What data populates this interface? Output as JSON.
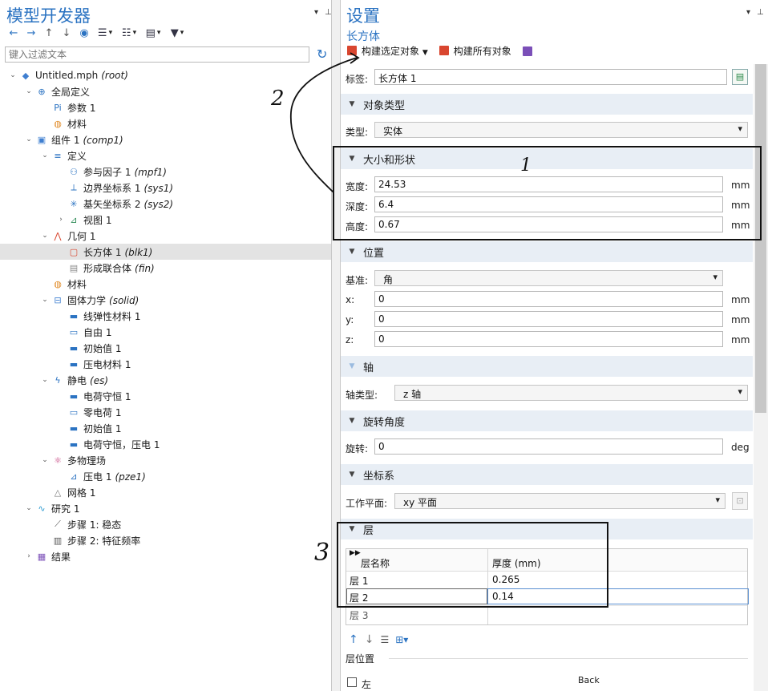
{
  "left_panel": {
    "title": "模型开发器",
    "toolbar": [
      "back-arrow-icon",
      "forward-arrow-icon",
      "up-arrow-icon",
      "down-arrow-icon",
      "eye-icon",
      "expand-icon",
      "collapse-icon",
      "list-icon",
      "pin-menu-icon"
    ],
    "filter_placeholder": "键入过滤文本",
    "tree": [
      {
        "indent": 0,
        "caret": "v",
        "icon": "file-root-icon",
        "label": "Untitled.mph",
        "tag": "(root)",
        "color": "#3f7fd0"
      },
      {
        "indent": 1,
        "caret": "v",
        "icon": "globe-icon",
        "label": "全局定义",
        "tag": "",
        "color": "#2b73c2"
      },
      {
        "indent": 2,
        "caret": "",
        "icon": "param-icon",
        "label": "参数 1",
        "tag": "",
        "color": "#2b73c2"
      },
      {
        "indent": 2,
        "caret": "",
        "icon": "material-icon",
        "label": "材料",
        "tag": "",
        "color": "#e08a25"
      },
      {
        "indent": 1,
        "caret": "v",
        "icon": "component-icon",
        "label": "组件 1",
        "tag": "(comp1)",
        "color": "#3f7fd0"
      },
      {
        "indent": 2,
        "caret": "v",
        "icon": "definitions-icon",
        "label": "定义",
        "tag": "",
        "color": "#2b73c2"
      },
      {
        "indent": 3,
        "caret": "",
        "icon": "participation-icon",
        "label": "参与因子 1",
        "tag": "(mpf1)",
        "color": "#2b73c2"
      },
      {
        "indent": 3,
        "caret": "",
        "icon": "boundary-system-icon",
        "label": "边界坐标系 1",
        "tag": "(sys1)",
        "color": "#2b73c2"
      },
      {
        "indent": 3,
        "caret": "",
        "icon": "base-vector-icon",
        "label": "基矢坐标系 2",
        "tag": "(sys2)",
        "color": "#2b73c2"
      },
      {
        "indent": 3,
        "caret": ">",
        "icon": "view-icon",
        "label": "视图 1",
        "tag": "",
        "color": "#2e8b57"
      },
      {
        "indent": 2,
        "caret": "v",
        "icon": "geometry-icon",
        "label": "几何 1",
        "tag": "",
        "color": "#d9462f"
      },
      {
        "indent": 3,
        "caret": "",
        "icon": "block-icon",
        "label": "长方体 1",
        "tag": "(blk1)",
        "color": "#d9462f",
        "selected": true
      },
      {
        "indent": 3,
        "caret": "",
        "icon": "form-union-icon",
        "label": "形成联合体",
        "tag": "(fin)",
        "color": "#888888"
      },
      {
        "indent": 2,
        "caret": "",
        "icon": "material-icon",
        "label": "材料",
        "tag": "",
        "color": "#e08a25"
      },
      {
        "indent": 2,
        "caret": "v",
        "icon": "solid-mechanics-icon",
        "label": "固体力学",
        "tag": "(solid)",
        "color": "#3f7fd0"
      },
      {
        "indent": 3,
        "caret": "",
        "icon": "domain-feature-icon",
        "label": "线弹性材料 1",
        "tag": "",
        "color": "#2b73c2"
      },
      {
        "indent": 3,
        "caret": "",
        "icon": "boundary-feature-icon",
        "label": "自由 1",
        "tag": "",
        "color": "#2b73c2"
      },
      {
        "indent": 3,
        "caret": "",
        "icon": "domain-feature-icon",
        "label": "初始值 1",
        "tag": "",
        "color": "#2b73c2"
      },
      {
        "indent": 3,
        "caret": "",
        "icon": "domain-feature-icon",
        "label": "压电材料 1",
        "tag": "",
        "color": "#2b73c2"
      },
      {
        "indent": 2,
        "caret": "v",
        "icon": "electrostatics-icon",
        "label": "静电",
        "tag": "(es)",
        "color": "#2b73c2"
      },
      {
        "indent": 3,
        "caret": "",
        "icon": "domain-feature-icon",
        "label": "电荷守恒 1",
        "tag": "",
        "color": "#2b73c2"
      },
      {
        "indent": 3,
        "caret": "",
        "icon": "boundary-feature-icon",
        "label": "零电荷 1",
        "tag": "",
        "color": "#2b73c2"
      },
      {
        "indent": 3,
        "caret": "",
        "icon": "domain-feature-icon",
        "label": "初始值 1",
        "tag": "",
        "color": "#2b73c2"
      },
      {
        "indent": 3,
        "caret": "",
        "icon": "domain-feature-icon",
        "label": "电荷守恒，压电 1",
        "tag": "",
        "color": "#2b73c2"
      },
      {
        "indent": 2,
        "caret": "v",
        "icon": "multiphysics-icon",
        "label": "多物理场",
        "tag": "",
        "color": "#c23b7a"
      },
      {
        "indent": 3,
        "caret": "",
        "icon": "piezo-coupling-icon",
        "label": "压电 1",
        "tag": "(pze1)",
        "color": "#2b73c2"
      },
      {
        "indent": 2,
        "caret": "",
        "icon": "mesh-icon",
        "label": "网格 1",
        "tag": "",
        "color": "#777777"
      },
      {
        "indent": 1,
        "caret": "v",
        "icon": "study-icon",
        "label": "研究 1",
        "tag": "",
        "color": "#2b9ad0"
      },
      {
        "indent": 2,
        "caret": "",
        "icon": "stationary-step-icon",
        "label": "步骤 1: 稳态",
        "tag": "",
        "color": "#555555"
      },
      {
        "indent": 2,
        "caret": "",
        "icon": "eigenfrequency-step-icon",
        "label": "步骤 2: 特征频率",
        "tag": "",
        "color": "#555555"
      },
      {
        "indent": 1,
        "caret": ">",
        "icon": "results-icon",
        "label": "结果",
        "tag": "",
        "color": "#7b4fb8"
      }
    ]
  },
  "right_panel": {
    "title": "设置",
    "subtitle": "长方体",
    "build_selected": "构建选定对象",
    "build_all": "构建所有对象",
    "label_caption": "标签:",
    "label_value": "长方体 1",
    "sections": {
      "object_type": "对象类型",
      "size_shape": "大小和形状",
      "position": "位置",
      "axis": "轴",
      "rotation": "旋转角度",
      "coord_system": "坐标系",
      "layers": "层"
    },
    "type_caption": "类型:",
    "type_value": "实体",
    "width_caption": "宽度:",
    "width_value": "24.53",
    "depth_caption": "深度:",
    "depth_value": "6.4",
    "height_caption": "高度:",
    "height_value": "0.67",
    "unit_mm": "mm",
    "base_caption": "基准:",
    "base_value": "角",
    "x_caption": "x:",
    "x_value": "0",
    "y_caption": "y:",
    "y_value": "0",
    "z_caption": "z:",
    "z_value": "0",
    "axis_type_caption": "轴类型:",
    "axis_type_value": "z 轴",
    "rotation_caption": "旋转:",
    "rotation_value": "0",
    "unit_deg": "deg",
    "workplane_caption": "工作平面:",
    "workplane_value": "xy 平面",
    "layer_table": {
      "col_name": "层名称",
      "col_thickness": "厚度 (mm)",
      "rows": [
        {
          "name": "层 1",
          "thickness": "0.265"
        },
        {
          "name": "层 2",
          "thickness": "0.14"
        },
        {
          "name": "层 3",
          "thickness": ""
        }
      ]
    },
    "layer_position": "层位置",
    "left_checkbox": "左",
    "back_label": "Back"
  },
  "annotations": {
    "mark_1": "1",
    "mark_2": "2",
    "mark_3": "3"
  }
}
